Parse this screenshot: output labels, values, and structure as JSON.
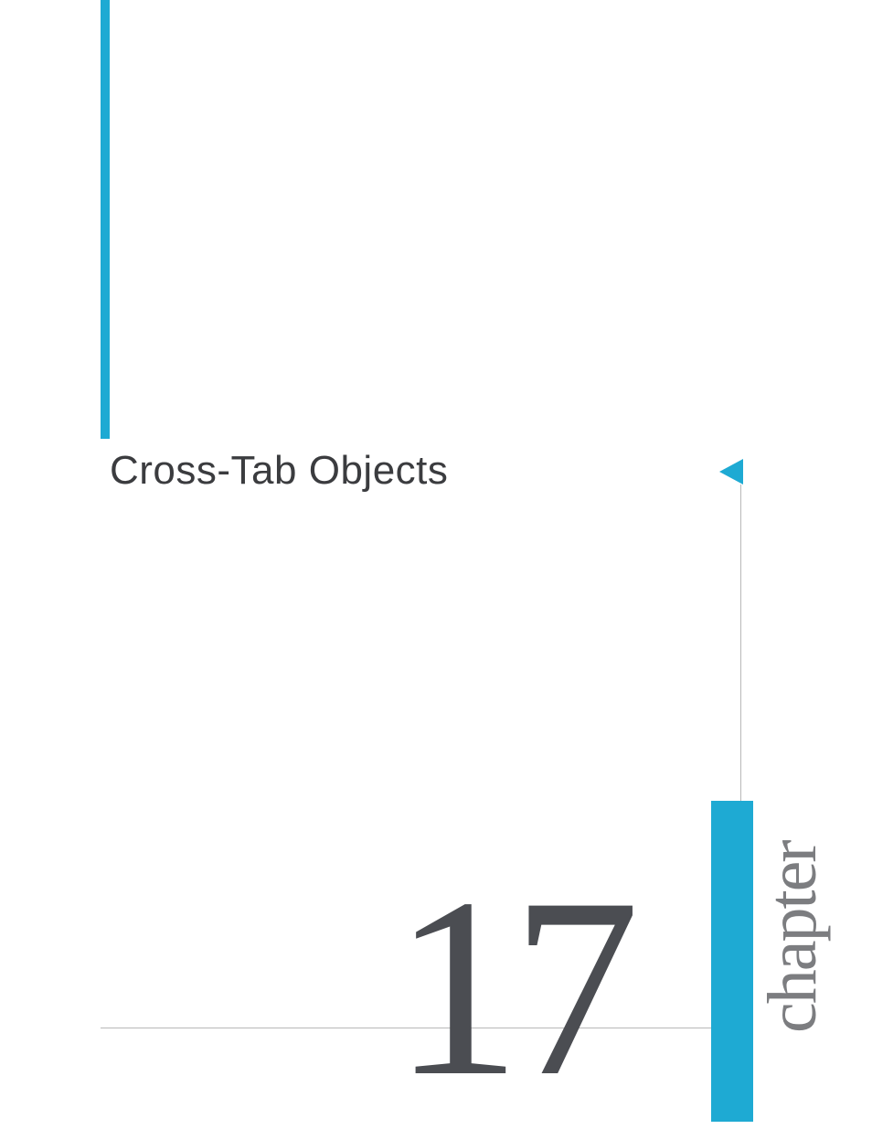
{
  "chapter": {
    "title": "Cross-Tab Objects",
    "number": "17",
    "label": "chapter"
  }
}
